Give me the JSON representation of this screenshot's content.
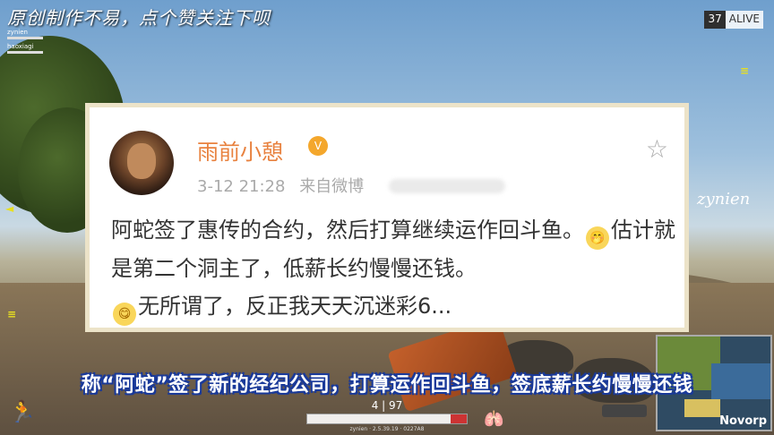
{
  "overlay": {
    "top_caption": "原创制作不易，点个赞关注下呗",
    "subtitle": "称“阿蛇”签了新的经纪公司，打算运作回斗鱼，签底薪长约慢慢还钱"
  },
  "hud": {
    "alive_count": "37",
    "alive_label": "ALIVE",
    "team_names": [
      "zynien",
      "haoxiagi"
    ],
    "player_tag": "zynien",
    "ammo": "4 | 97",
    "version": "zynien · 2.5.39.19 · 0227A8",
    "minimap_label": "Novorp",
    "health": 0.9
  },
  "post": {
    "username": "雨前小憩",
    "vip_badge": "V",
    "timestamp": "3-12 21:28",
    "source": "来自微博",
    "text_parts": [
      "阿蛇签了惠传的合约，然后打算继续运作回斗鱼。",
      "估计就是第二个洞主了，低薪长约慢慢还钱。",
      "无所谓了，反正我天天沉迷彩6..."
    ],
    "emoji_1": "🤭",
    "emoji_2": "😋",
    "star_icon": "☆"
  },
  "colors": {
    "username": "#e8813e",
    "subtitle_outline": "#1a3a9a",
    "card_border": "#ece3c8"
  }
}
